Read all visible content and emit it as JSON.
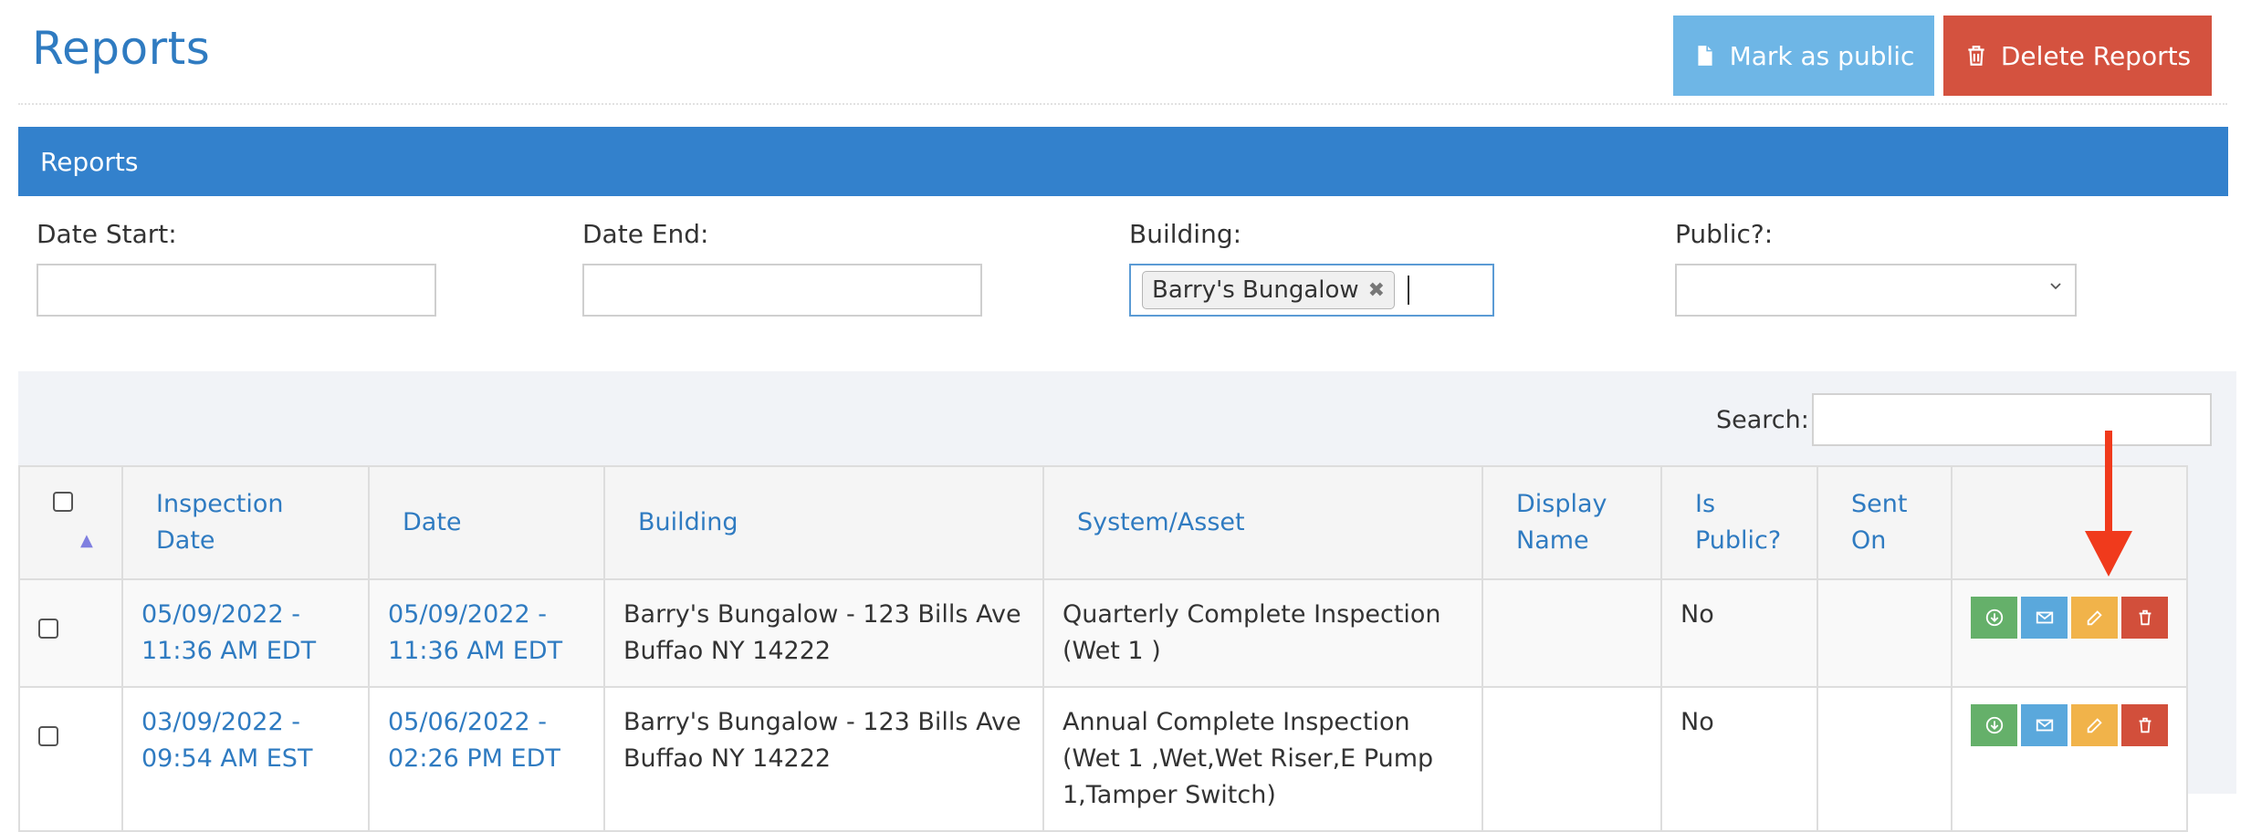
{
  "header": {
    "title": "Reports",
    "mark_public_label": "Mark as public",
    "delete_label": "Delete Reports"
  },
  "panel": {
    "title": "Reports"
  },
  "filters": {
    "date_start_label": "Date Start:",
    "date_end_label": "Date End:",
    "building_label": "Building:",
    "building_selected": "Barry's Bungalow",
    "public_label": "Public?:"
  },
  "search": {
    "label": "Search:"
  },
  "table": {
    "columns": [
      "Inspection Date",
      "Date",
      "Building",
      "System/Asset",
      "Display Name",
      "Is Public?",
      "Sent On"
    ],
    "rows": [
      {
        "inspection_date": "05/09/2022 - 11:36 AM EDT",
        "date": "05/09/2022 - 11:36 AM EDT",
        "building": "Barry's Bungalow - 123 Bills Ave Buffao NY 14222",
        "system_asset": "Quarterly Complete Inspection (Wet 1 )",
        "display_name": "",
        "is_public": "No",
        "sent_on": ""
      },
      {
        "inspection_date": "03/09/2022 - 09:54 AM EST",
        "date": "05/06/2022 - 02:26 PM EDT",
        "building": "Barry's Bungalow - 123 Bills Ave Buffao NY 14222",
        "system_asset": "Annual Complete Inspection (Wet 1 ,Wet,Wet Riser,E Pump 1,Tamper Switch)",
        "display_name": "",
        "is_public": "No",
        "sent_on": ""
      }
    ]
  },
  "row_actions": [
    "download-icon",
    "email-icon",
    "edit-icon",
    "trash-icon"
  ],
  "colors": {
    "accent": "#3381cc",
    "link": "#2f7bc1",
    "mark_public": "#6eb6e6",
    "delete": "#d4523f",
    "action_download": "#65b06a",
    "action_email": "#5aa8dc",
    "action_edit": "#f1b34a",
    "action_delete": "#d24f3b",
    "annotation_arrow": "#f03a1c"
  }
}
